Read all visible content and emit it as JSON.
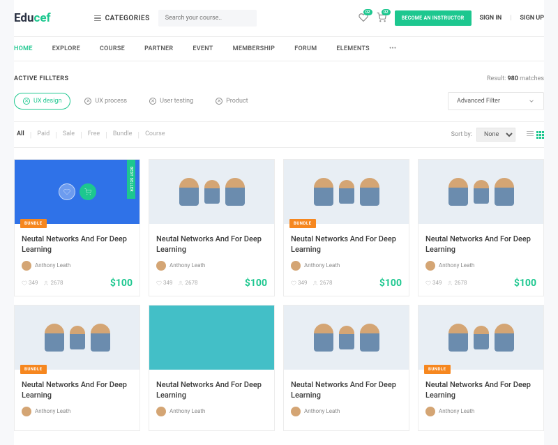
{
  "brand": {
    "part1": "Edu",
    "part2": "cef"
  },
  "header": {
    "categories": "CATEGORIES",
    "search_placeholder": "Search your course..",
    "wishlist_badge": "02",
    "cart_badge": "02",
    "cta": "BECOME AN INSTRUCTOR",
    "signin": "SIGN IN",
    "signup": "SIGN UP"
  },
  "nav": [
    "HOME",
    "EXPLORE",
    "COURSE",
    "PARTNER",
    "EVENT",
    "MEMBERSHIP",
    "FORUM",
    "ELEMENTS"
  ],
  "filters": {
    "label": "ACTIVE FILLTERS",
    "result_prefix": "Result: ",
    "result_count": "980",
    "result_suffix": " matches",
    "chips": [
      "UX design",
      "UX process",
      "User testing",
      "Product"
    ],
    "advanced": "Advanced Filter"
  },
  "sort": {
    "tabs": [
      "All",
      "Paid",
      "Sale",
      "Free",
      "Bundle",
      "Course"
    ],
    "label": "Sort by:",
    "value": "None"
  },
  "card": {
    "title": "Neutal Networks And For Deep Learning",
    "author": "Anthony Leath",
    "likes": "349",
    "students": "2678",
    "price": "$100",
    "tag": "BUNDLE",
    "bestseller": "BEST SELLER"
  }
}
